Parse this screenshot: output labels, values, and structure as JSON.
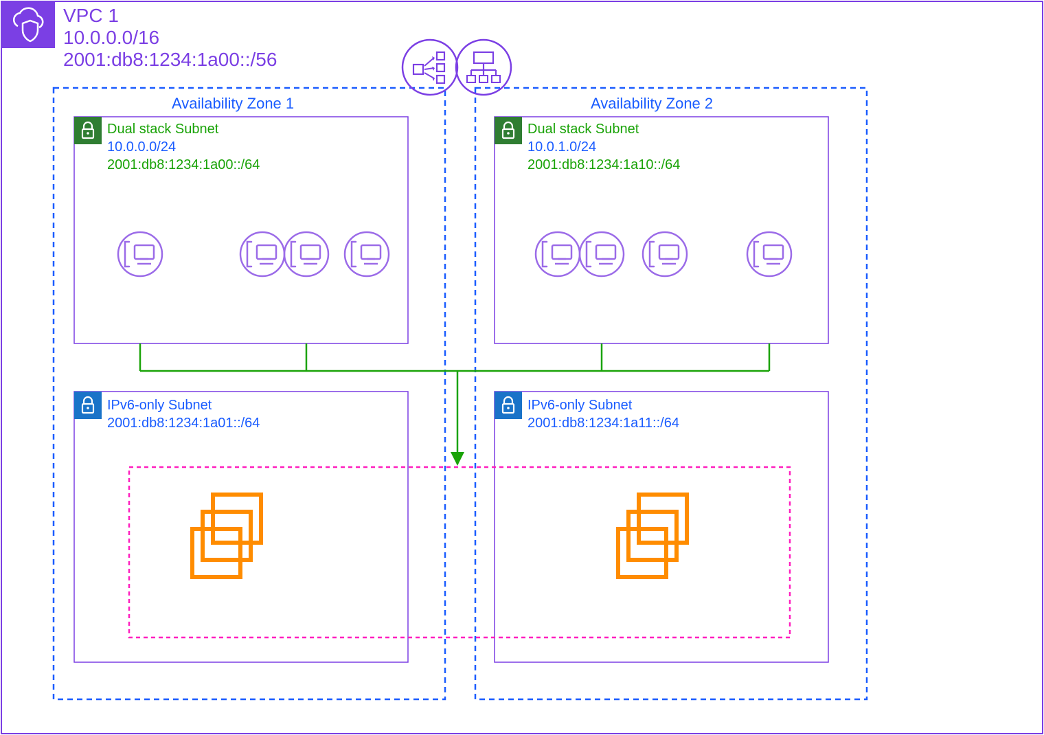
{
  "vpc": {
    "name": "VPC 1",
    "ipv4_cidr": "10.0.0.0/16",
    "ipv6_cidr": "2001:db8:1234:1a00::/56"
  },
  "az1": {
    "title": "Availability Zone 1",
    "dual_subnet": {
      "title": "Dual stack Subnet",
      "ipv4": "10.0.0.0/24",
      "ipv6": "2001:db8:1234:1a00::/64"
    },
    "ipv6_subnet": {
      "title": "IPv6-only Subnet",
      "ipv6": "2001:db8:1234:1a01::/64"
    }
  },
  "az2": {
    "title": "Availability Zone 2",
    "dual_subnet": {
      "title": "Dual stack Subnet",
      "ipv4": "10.0.1.0/24",
      "ipv6": "2001:db8:1234:1a10::/64"
    },
    "ipv6_subnet": {
      "title": "IPv6-only Subnet",
      "ipv6": "2001:db8:1234:1a11::/64"
    }
  },
  "colors": {
    "purple": "#7b3fe4",
    "blue": "#1a5cff",
    "green": "#1aa308",
    "orange": "#ff8c00",
    "magenta": "#ff1fbf",
    "subnet_green_fill": "#2f7d32",
    "subnet_blue_fill": "#1a73c8",
    "ec2_light": "#9b6be8"
  }
}
